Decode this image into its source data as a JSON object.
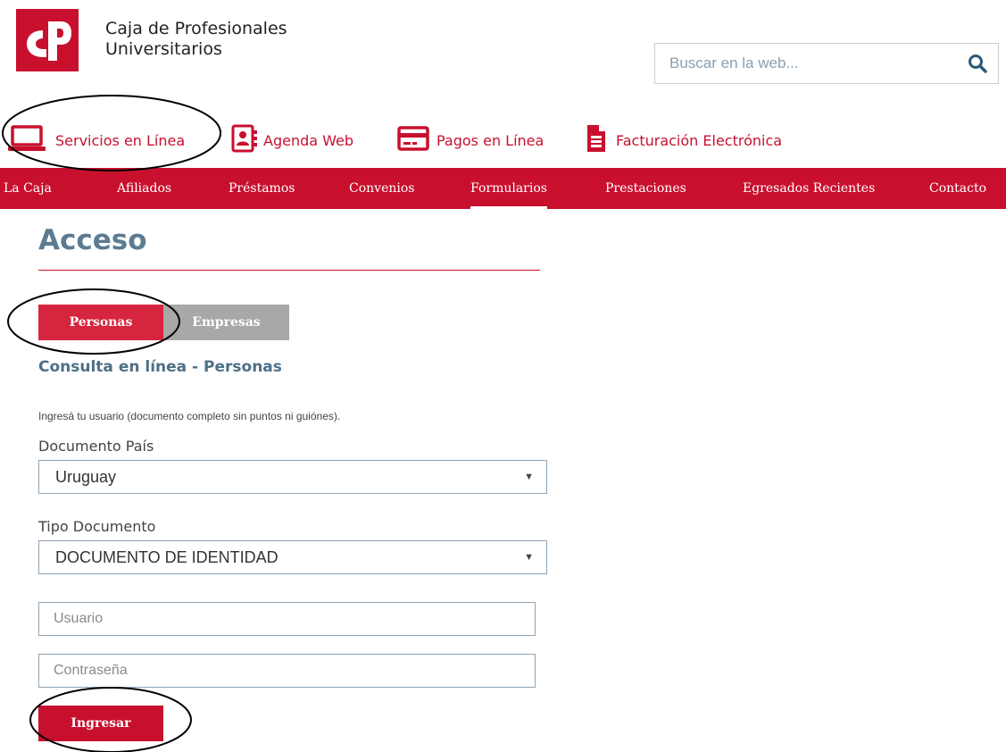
{
  "brand": {
    "line1": "Caja de Profesionales",
    "line2": "Universitarios",
    "logo_color": "#c8102e"
  },
  "search": {
    "placeholder": "Buscar en la web...",
    "icon": "search-icon"
  },
  "services": [
    {
      "label": "Servicios en Línea",
      "icon": "laptop-icon"
    },
    {
      "label": "Agenda Web",
      "icon": "contact-book-icon"
    },
    {
      "label": "Pagos en Línea",
      "icon": "credit-card-icon"
    },
    {
      "label": "Facturación Electrónica",
      "icon": "invoice-document-icon"
    }
  ],
  "nav": {
    "items": [
      {
        "label": "La Caja"
      },
      {
        "label": "Afiliados"
      },
      {
        "label": "Préstamos"
      },
      {
        "label": "Convenios"
      },
      {
        "label": "Formularios"
      },
      {
        "label": "Prestaciones"
      },
      {
        "label": "Egresados Recientes"
      },
      {
        "label": "Contacto"
      }
    ],
    "active": "Formularios"
  },
  "page": {
    "title": "Acceso",
    "tabs": [
      {
        "label": "Personas",
        "active": true
      },
      {
        "label": "Empresas",
        "active": false
      }
    ],
    "subtitle": "Consulta en línea - Personas",
    "hint": "Ingresá tu usuario (documento completo sin puntos ni guiónes)."
  },
  "form": {
    "country_label": "Documento País",
    "country_value": "Uruguay",
    "doctype_label": "Tipo Documento",
    "doctype_value": "DOCUMENTO DE IDENTIDAD",
    "user_placeholder": "Usuario",
    "password_placeholder": "Contraseña",
    "submit_label": "Ingresar"
  },
  "colors": {
    "accent": "#c8102e",
    "heading": "#5b7c91",
    "inactive_tab": "#a8a8a8"
  }
}
